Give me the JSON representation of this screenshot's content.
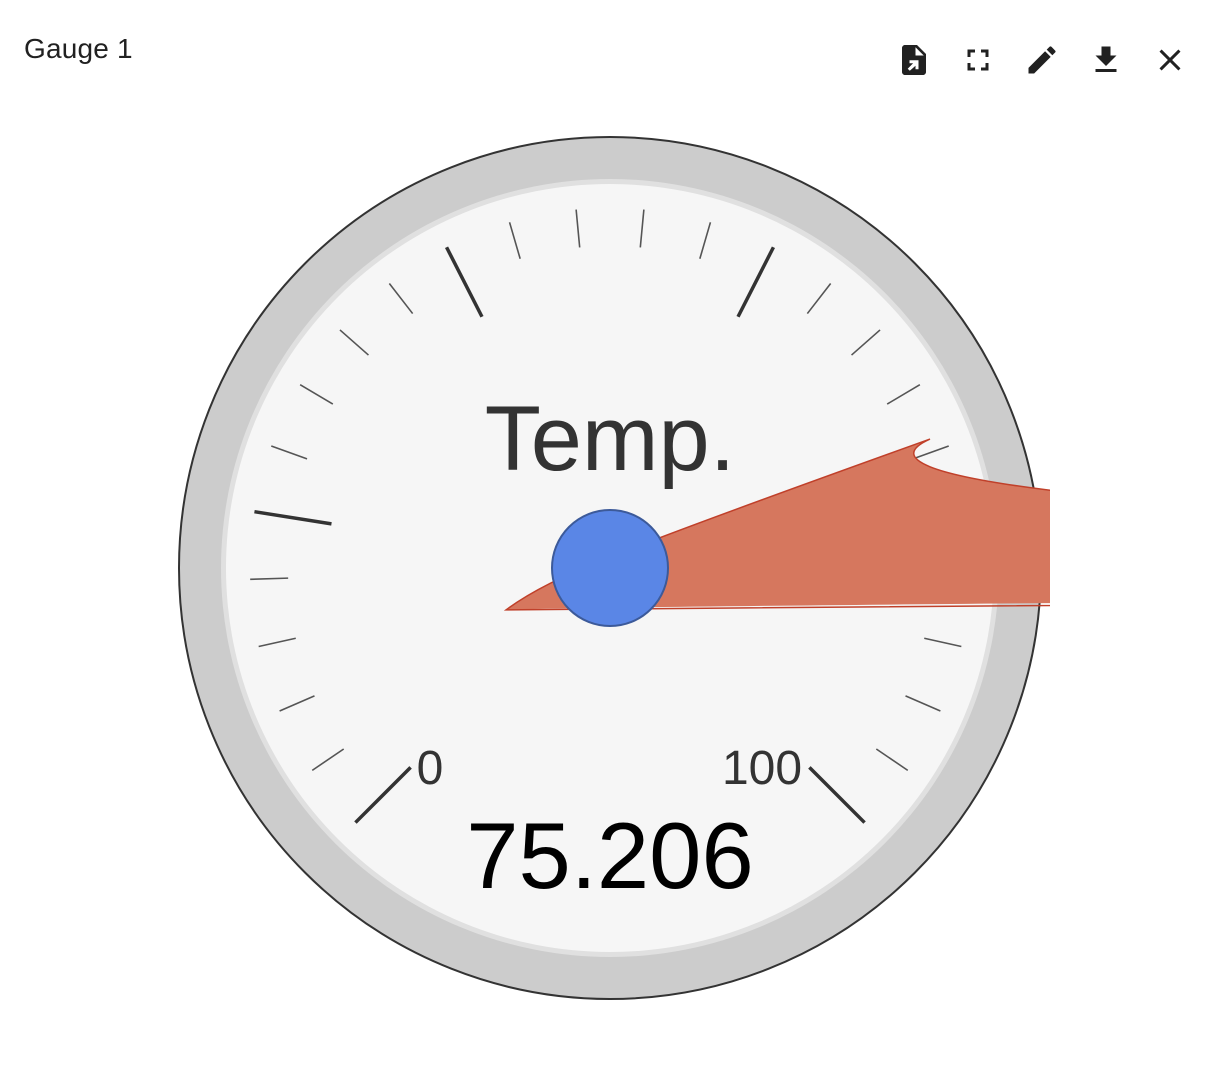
{
  "panel": {
    "title": "Gauge 1"
  },
  "toolbar": {
    "buttons": [
      {
        "name": "export-data-button",
        "icon": "export-file-icon"
      },
      {
        "name": "fullscreen-button",
        "icon": "fullscreen-icon"
      },
      {
        "name": "edit-button",
        "icon": "pencil-icon"
      },
      {
        "name": "download-button",
        "icon": "download-icon"
      },
      {
        "name": "close-button",
        "icon": "close-icon"
      }
    ]
  },
  "gauge": {
    "label": "Temp.",
    "value": 75.206,
    "value_text": "75.206",
    "min": 0,
    "max": 100,
    "min_label": "0",
    "max_label": "100",
    "major_ticks": 5,
    "minor_ticks_per_major": 5,
    "colors": {
      "bezel": "#cccccc",
      "face": "#f6f6f6",
      "needle": "#d6775e",
      "needle_stroke": "#c0402a",
      "hub": "#5a86e6",
      "tick": "#333333",
      "label": "#333333",
      "value": "#000000"
    }
  }
}
